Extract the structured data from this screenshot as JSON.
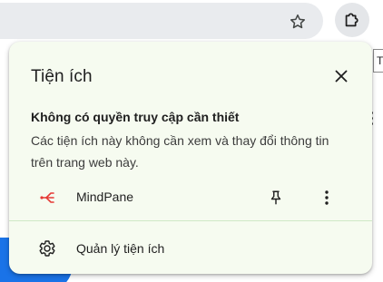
{
  "toolbar": {
    "bookmark_icon": "star-outline-icon",
    "extensions_icon": "puzzle-piece-icon",
    "tooltip_text": "Ti"
  },
  "popup": {
    "title": "Tiện ích",
    "close_icon": "close-icon",
    "section": {
      "heading": "Không có quyền truy cập cần thiết",
      "description": "Các tiện ích này không cần xem và thay đổi thông tin trên trang web này."
    },
    "extensions": [
      {
        "name": "MindPane",
        "icon": "mindpane-logo-icon",
        "icon_color": "#e53935"
      }
    ],
    "manage": {
      "label": "Quản lý tiện ích",
      "icon": "gear-icon"
    }
  },
  "colors": {
    "popup_background": "#f6fbf0",
    "divider": "#cfe8c6",
    "omnibox": "#e9ebee",
    "page_accent": "#1a73e8"
  }
}
